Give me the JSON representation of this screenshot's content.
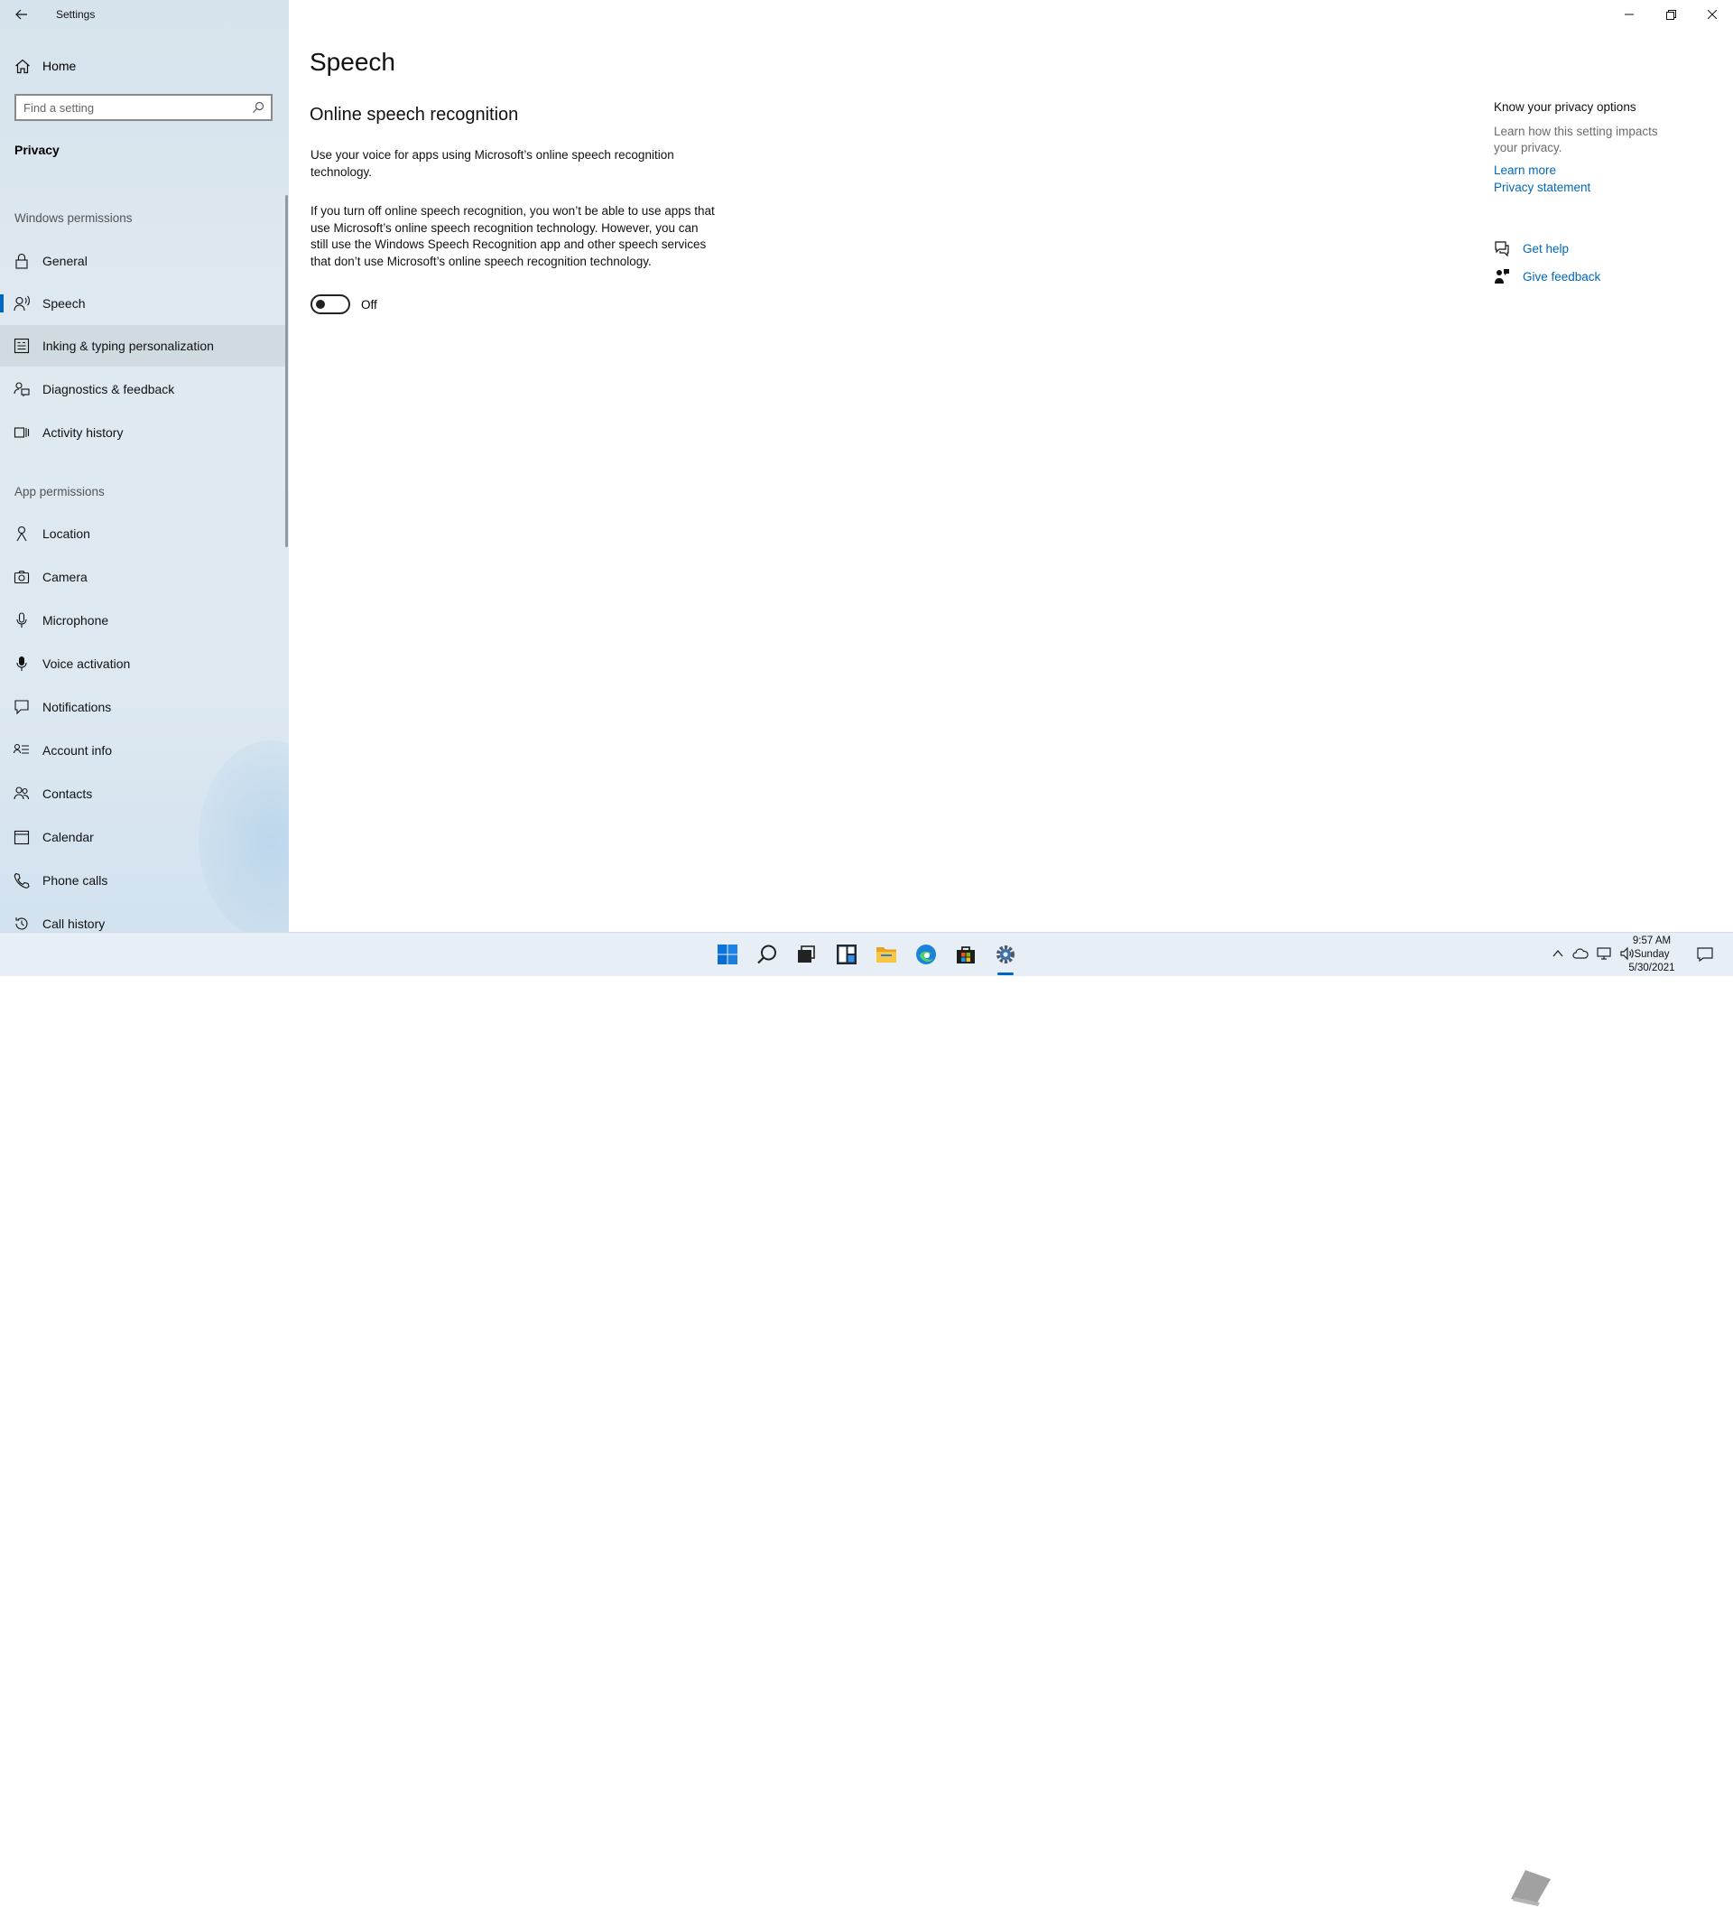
{
  "window": {
    "title": "Settings"
  },
  "sidebar": {
    "home_label": "Home",
    "search_placeholder": "Find a setting",
    "section_title": "Privacy",
    "groups": [
      {
        "header": "Windows permissions",
        "items": [
          {
            "label": "General",
            "icon": "lock-icon"
          },
          {
            "label": "Speech",
            "icon": "speech-icon",
            "selected": true
          },
          {
            "label": "Inking & typing personalization",
            "icon": "inking-icon",
            "hover": true
          },
          {
            "label": "Diagnostics & feedback",
            "icon": "diagnostics-icon"
          },
          {
            "label": "Activity history",
            "icon": "activity-history-icon"
          }
        ]
      },
      {
        "header": "App permissions",
        "items": [
          {
            "label": "Location",
            "icon": "location-icon"
          },
          {
            "label": "Camera",
            "icon": "camera-icon"
          },
          {
            "label": "Microphone",
            "icon": "microphone-icon"
          },
          {
            "label": "Voice activation",
            "icon": "voice-activation-icon"
          },
          {
            "label": "Notifications",
            "icon": "notifications-icon"
          },
          {
            "label": "Account info",
            "icon": "account-info-icon"
          },
          {
            "label": "Contacts",
            "icon": "contacts-icon"
          },
          {
            "label": "Calendar",
            "icon": "calendar-icon"
          },
          {
            "label": "Phone calls",
            "icon": "phone-calls-icon"
          },
          {
            "label": "Call history",
            "icon": "call-history-icon"
          }
        ]
      }
    ]
  },
  "main": {
    "page_title": "Speech",
    "section_title": "Online speech recognition",
    "description_1": "Use your voice for apps using Microsoft’s online speech recognition technology.",
    "description_2": "If you turn off online speech recognition, you won’t be able to use apps that use Microsoft’s online speech recognition technology.  However, you can still use the Windows Speech Recognition app and other speech services that don’t use Microsoft’s online speech recognition technology.",
    "toggle": {
      "state_label": "Off",
      "on": false
    }
  },
  "right_pane": {
    "header": "Know your privacy options",
    "text": "Learn how this setting impacts your privacy.",
    "learn_more": "Learn more",
    "privacy_statement": "Privacy statement",
    "get_help": "Get help",
    "give_feedback": "Give feedback"
  },
  "taskbar": {
    "time": "9:57 AM",
    "day": "Sunday",
    "date": "5/30/2021",
    "apps": [
      "start-icon",
      "search-icon",
      "task-view-icon",
      "widgets-icon",
      "file-explorer-icon",
      "edge-icon",
      "store-icon",
      "settings-icon"
    ],
    "active_app": "settings-icon"
  },
  "colors": {
    "accent": "#0067c0",
    "link": "#0067b8",
    "sidebar_bg": "#dde8f1"
  }
}
